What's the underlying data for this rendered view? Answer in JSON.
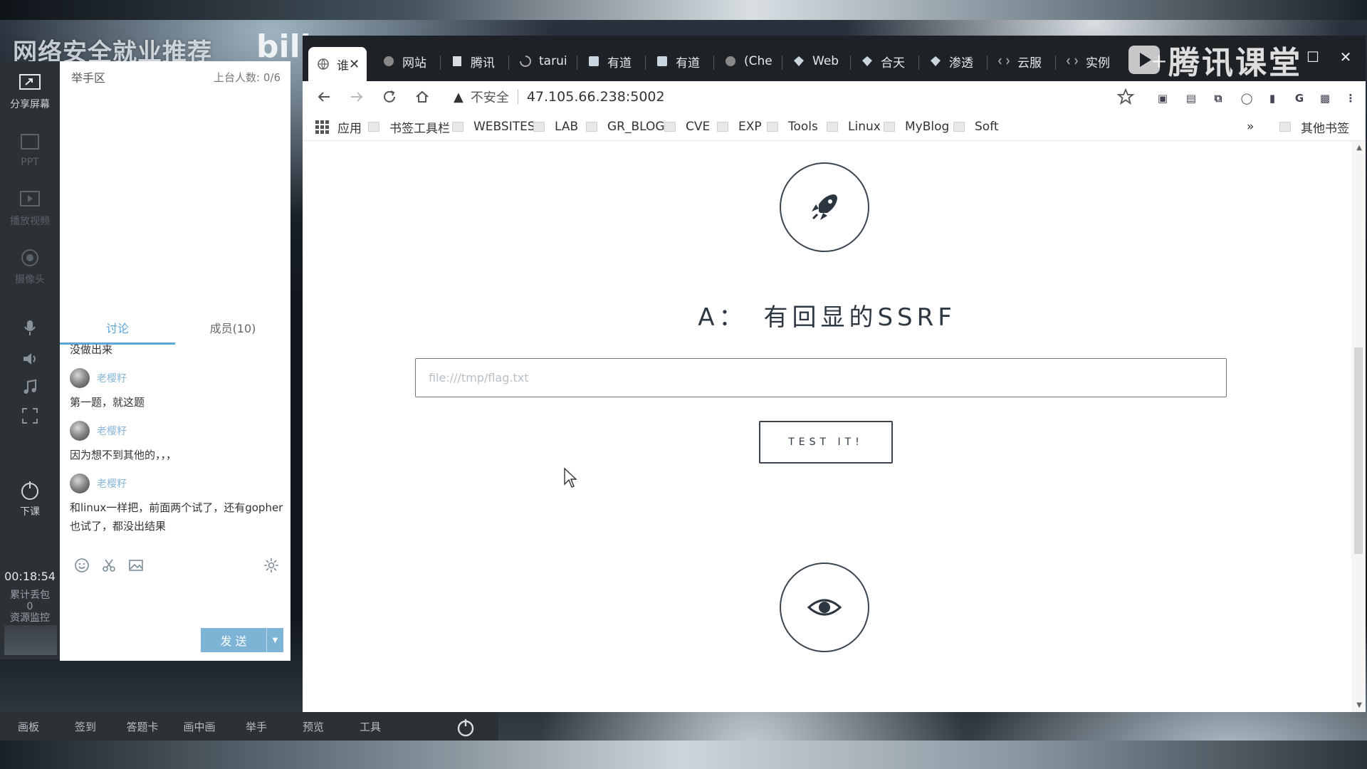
{
  "overlay": {
    "title": "网络安全就业推荐",
    "bili": "bili"
  },
  "rail": {
    "share_screen": "分享屏幕",
    "ppt": "PPT",
    "play_video": "播放视频",
    "camera": "摄像头",
    "end_class": "下课",
    "timer": "00:18:54",
    "note1": "累计丢包",
    "note2": "0",
    "note3": "资源监控"
  },
  "chat": {
    "hand_title": "举手区",
    "hand_count": "上台人数: 0/6",
    "tab_discuss": "讨论",
    "tab_members": "成员(10)",
    "messages": [
      {
        "user": "",
        "text": "没做出来"
      },
      {
        "user": "老樱籽",
        "text": "第一题，就这题"
      },
      {
        "user": "老樱籽",
        "text": "因为想不到其他的，，，"
      },
      {
        "user": "老樱籽",
        "text": "和linux一样把，前面两个试了，还有gopher也试了，都没出结果"
      }
    ],
    "send_label": "发 送"
  },
  "bottom_bar": {
    "items": [
      "画板",
      "签到",
      "答题卡",
      "画中画",
      "举手",
      "预览",
      "工具"
    ]
  },
  "browser": {
    "tabs": [
      {
        "label": "谁",
        "icon": "globe-icon",
        "active": true
      },
      {
        "label": "网站",
        "icon": "globe-icon"
      },
      {
        "label": "腾讯",
        "icon": "doc-icon"
      },
      {
        "label": "tarui",
        "icon": "loading-icon"
      },
      {
        "label": "有道",
        "icon": "note-icon"
      },
      {
        "label": "有道",
        "icon": "note-icon"
      },
      {
        "label": "(Che",
        "icon": "globe-icon"
      },
      {
        "label": "Web",
        "icon": "diamond-icon"
      },
      {
        "label": "合天",
        "icon": "diamond-icon"
      },
      {
        "label": "渗透",
        "icon": "diamond-icon"
      },
      {
        "label": "云服",
        "icon": "cloud-icon"
      },
      {
        "label": "实例",
        "icon": "cloud-icon"
      }
    ],
    "tencent_logo": "腾讯课堂",
    "address": {
      "security_label": "不安全",
      "url": "47.105.66.238:5002"
    },
    "bookmarks": [
      {
        "label": "应用",
        "type": "apps"
      },
      {
        "label": "书签工具栏",
        "type": "folder"
      },
      {
        "label": "WEBSITES",
        "type": "folder"
      },
      {
        "label": "LAB",
        "type": "folder"
      },
      {
        "label": "GR_BLOG",
        "type": "folder"
      },
      {
        "label": "CVE",
        "type": "folder"
      },
      {
        "label": "EXP",
        "type": "folder"
      },
      {
        "label": "Tools",
        "type": "folder"
      },
      {
        "label": "Linux",
        "type": "folder"
      },
      {
        "label": "MyBlog",
        "type": "folder"
      },
      {
        "label": "Soft",
        "type": "folder"
      },
      {
        "label": "其他书签",
        "type": "folder"
      }
    ],
    "bookmarks_more": "»"
  },
  "page": {
    "heading": "A：　有回显的SSRF",
    "input_placeholder": "file:///tmp/flag.txt",
    "button_label": "TEST IT!"
  },
  "colors": {
    "accent": "#5aa6d6",
    "send_button": "#7db4d6",
    "tab_strip": "#1e2226",
    "rail": "#2c3136"
  }
}
